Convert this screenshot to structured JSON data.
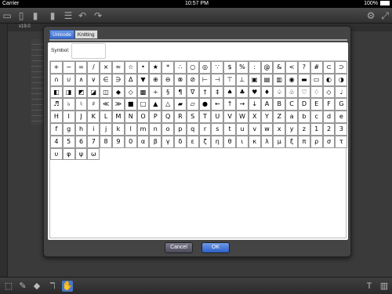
{
  "status_bar": {
    "carrier": "Carrier",
    "time": "10:57 PM",
    "battery": "100%"
  },
  "canvas": {
    "size_label": "x19.0"
  },
  "dialog": {
    "tabs": [
      {
        "label": "Unicode",
        "selected": true
      },
      {
        "label": "Knitting",
        "selected": false
      }
    ],
    "symbol_label": "Symbol:",
    "symbol_value": "",
    "cancel_label": "Cancel",
    "ok_label": "OK",
    "symbols": [
      "+",
      "−",
      "=",
      "/",
      "×",
      "≈",
      "☆",
      "•",
      "★",
      "*",
      "∴",
      "○",
      "◎",
      "∵",
      "$",
      "%",
      ":",
      "@",
      "&",
      "<",
      "?",
      "#",
      "⊂",
      "⊃",
      "∩",
      "∪",
      "∧",
      "∨",
      "∈",
      "∋",
      "Δ",
      "▼",
      "⊕",
      "⊖",
      "⊗",
      "⊘",
      "⊢",
      "⊣",
      "⊤",
      "⊥",
      "▣",
      "▤",
      "▥",
      "◉",
      "▬",
      "▭",
      "◐",
      "◑",
      "◧",
      "◨",
      "◩",
      "◪",
      "◫",
      "◆",
      "◇",
      "▩",
      "÷",
      "§",
      "¶",
      "∇",
      "†",
      "‡",
      "♠",
      "♣",
      "♥",
      "♦",
      "♤",
      "♧",
      "♡",
      "♢",
      "◇",
      "♩",
      "♬",
      "♭",
      "♮",
      "♯",
      "≪",
      "≫",
      "■",
      "□",
      "▲",
      "△",
      "▰",
      "▱",
      "●",
      "←",
      "↑",
      "→",
      "↓",
      "A",
      "B",
      "C",
      "D",
      "E",
      "F",
      "G",
      "H",
      "I",
      "J",
      "K",
      "L",
      "M",
      "N",
      "O",
      "P",
      "Q",
      "R",
      "S",
      "T",
      "U",
      "V",
      "W",
      "X",
      "Y",
      "Z",
      "a",
      "b",
      "c",
      "d",
      "e",
      "f",
      "g",
      "h",
      "i",
      "j",
      "k",
      "l",
      "m",
      "n",
      "o",
      "p",
      "q",
      "r",
      "s",
      "t",
      "u",
      "v",
      "w",
      "x",
      "y",
      "z",
      "1",
      "2",
      "3",
      "4",
      "5",
      "6",
      "7",
      "8",
      "9",
      "0",
      "α",
      "β",
      "γ",
      "δ",
      "ε",
      "ζ",
      "η",
      "θ",
      "ι",
      "κ",
      "λ",
      "μ",
      "ξ",
      "π",
      "ρ",
      "σ",
      "τ",
      "υ",
      "φ",
      "ψ",
      "ω"
    ]
  },
  "colors": {
    "accent": "#3a6cd0",
    "dialog_bg": "#444444"
  },
  "icons": {
    "top_left": [
      "folder-icon",
      "add-file-icon",
      "save-icon",
      "duplicate-icon",
      "list-icon",
      "undo-icon",
      "redo-icon"
    ],
    "top_right": [
      "settings-icon",
      "expand-icon"
    ],
    "bottom_left": [
      "select-icon",
      "pen-icon",
      "eraser-icon",
      "symbol-icon",
      "hand-icon"
    ],
    "bottom_right": [
      "text-icon",
      "layout-icon"
    ]
  }
}
